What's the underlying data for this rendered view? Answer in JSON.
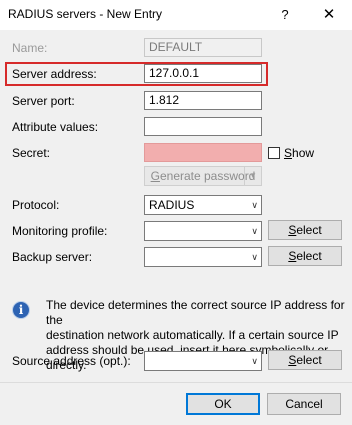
{
  "window": {
    "title": "RADIUS servers - New Entry",
    "help_glyph": "?",
    "close_glyph": "✕"
  },
  "form": {
    "name": {
      "label": "Name:",
      "value": "DEFAULT"
    },
    "server_address": {
      "label": "Server address:",
      "value": "127.0.0.1"
    },
    "server_port": {
      "label": "Server port:",
      "value": "1.812"
    },
    "attribute_values": {
      "label": "Attribute values:",
      "value": ""
    },
    "secret": {
      "label": "Secret:",
      "value": "",
      "show_label_u": "S",
      "show_label_rest": "how",
      "show_checked": false
    },
    "generate_password": {
      "label_u": "G",
      "label_rest": "enerate password",
      "arrow": "▼"
    },
    "protocol": {
      "label": "Protocol:",
      "value": "RADIUS",
      "arrow": "∨"
    },
    "monitoring_profile": {
      "label": "Monitoring profile:",
      "value": "",
      "arrow": "∨",
      "select_u": "S",
      "select_rest": "elect"
    },
    "backup_server": {
      "label": "Backup server:",
      "value": "",
      "arrow": "∨",
      "select_u": "S",
      "select_rest": "elect"
    },
    "info_icon_glyph": "i",
    "info_lines": [
      "The device determines the correct source IP address for the",
      "destination network automatically. If a certain source IP",
      "address should be used, insert it here symbolically or directly."
    ],
    "source_address": {
      "label": "Source address (opt.):",
      "value": "",
      "arrow": "∨",
      "select_u": "S",
      "select_rest": "elect"
    }
  },
  "buttons": {
    "ok": "OK",
    "cancel": "Cancel"
  },
  "colors": {
    "highlight": "#d62a2a",
    "secret_bg": "#f2aeae",
    "info_icon": "#2d63b3",
    "default_button_border": "#0078d7"
  }
}
